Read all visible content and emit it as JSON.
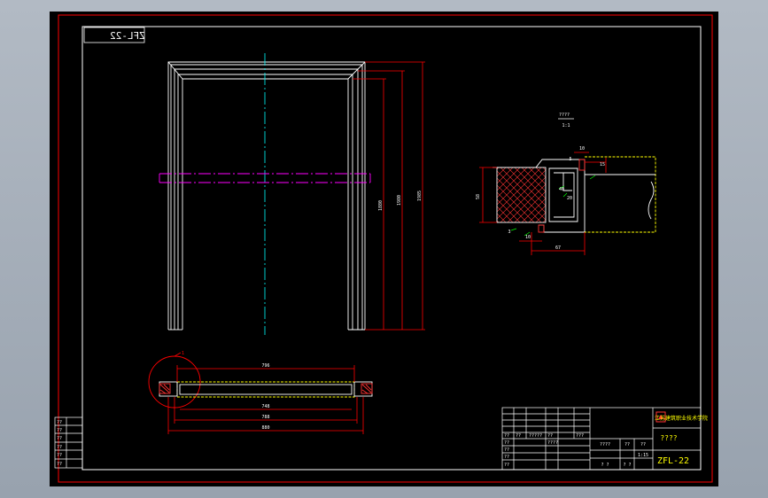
{
  "drawing": {
    "code_box_mirrored": "ZFL-22",
    "section_title": "????",
    "section_scale": "1:1",
    "detail_marker": "1"
  },
  "front_view_dims": {
    "inner_height": "1880",
    "mid_height": "1980",
    "outer_height": "1985"
  },
  "plan_view_dims": {
    "top_width": "796",
    "inner_width": "748",
    "mid_width": "788",
    "outer_width": "880"
  },
  "section_dims": {
    "height": "58",
    "top_left": "10",
    "top_right": "15",
    "left_small": "5",
    "mid": "40",
    "mid2": "20",
    "bottom_left": "3",
    "bottom_right": "10",
    "bottom_width": "67"
  },
  "title_block": {
    "company": "江苏建筑职业技术学院",
    "part_name": "????",
    "drawing_no": "ZFL-22",
    "row_labels": [
      "??",
      "??",
      "??",
      "??",
      "??",
      "??"
    ],
    "sign_row1": [
      "??",
      "??",
      "?????",
      "??",
      "???"
    ],
    "sign_left": [
      "??",
      "??",
      "??",
      "??"
    ],
    "sign_mid": [
      "????",
      "??",
      "??"
    ],
    "sign_mid2": [
      "? ?",
      "? ?"
    ],
    "scale": "1:15",
    "mid_col": "????"
  },
  "colors": {
    "background": "#000000",
    "border": "#ff0000",
    "frame": "#ffffff",
    "centerline": "#00ffff",
    "section_line": "#ff00ff",
    "dimension": "#ff0000",
    "text": "#ffffff",
    "highlight": "#ffff00",
    "leader": "#00ff00"
  }
}
